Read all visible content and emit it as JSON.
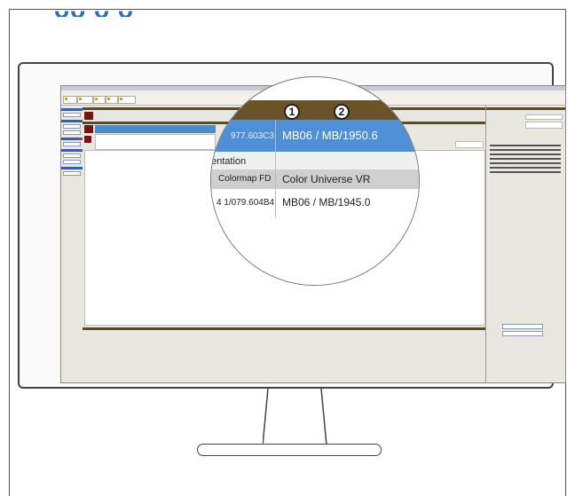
{
  "magnifier": {
    "badges": [
      "1",
      "2"
    ],
    "row1": {
      "left_value": "977.603C3",
      "right_value": "MB06 / MB/1950.6"
    },
    "section_label": "entation",
    "header": {
      "left": "Colormap FD",
      "right": "Color Universe VR"
    },
    "row2": {
      "left_value": "4 1/079.604B4",
      "right_value": "MB06 / MB/1945.0"
    }
  },
  "colors": {
    "title_blue": "#2e6fb5",
    "highlight_blue": "#4e8fd6",
    "bar_brown": "#6b5327",
    "swatch_red": "#7a1010"
  }
}
